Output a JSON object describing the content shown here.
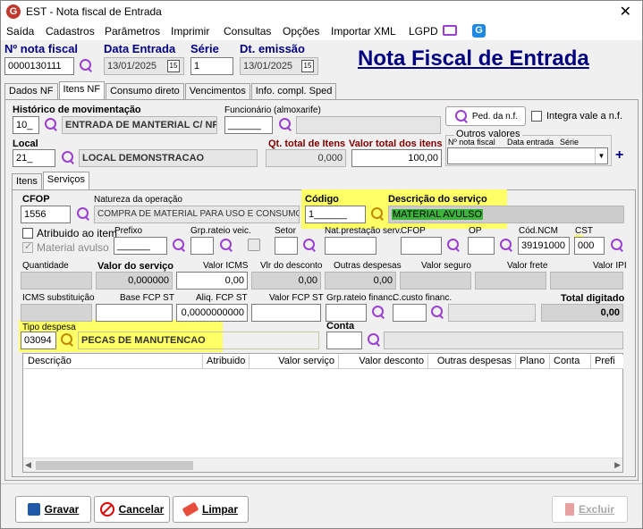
{
  "window": {
    "title": "EST - Nota fiscal de Entrada",
    "icon": "G"
  },
  "menu": [
    "Saída",
    "Cadastros",
    "Parâmetros",
    "Imprimir",
    "Consultas",
    "Opções",
    "Importar XML",
    "LGPD"
  ],
  "header": {
    "nota_label": "Nº nota fiscal",
    "nota_value": "0000130111",
    "data_entrada_label": "Data Entrada",
    "data_entrada_value": "13/01/2025",
    "serie_label": "Série",
    "serie_value": "1",
    "dt_emissao_label": "Dt. emissão",
    "dt_emissao_value": "13/01/2025",
    "big_title": "Nota Fiscal de Entrada",
    "cal_glyph": "15"
  },
  "main_tabs": [
    "Dados NF",
    "Itens NF",
    "Consumo direto",
    "Vencimentos",
    "Info. compl. Sped"
  ],
  "itens": {
    "historico_label": "Histórico de movimentação",
    "historico_code": "10_",
    "historico_desc": "ENTRADA DE MANTERIAL C/ NF",
    "funcionario_label": "Funcionário (almoxarife)",
    "funcionario_value": "______",
    "ped_btn": "Ped. da n.f.",
    "integra_label": "Integra vale a n.f.",
    "outros_valores_label": "Outros valores",
    "ov_cols": [
      "Nº nota fiscal",
      "Data entrada",
      "Série"
    ],
    "local_label": "Local",
    "local_code": "21_",
    "local_desc": "LOCAL DEMONSTRACAO",
    "qt_total_label": "Qt. total de Itens",
    "qt_total_value": "0,000",
    "valor_total_label": "Valor total dos itens",
    "valor_total_value": "100,00",
    "plus": "+"
  },
  "sub_tabs": [
    "Itens",
    "Serviços"
  ],
  "servicos": {
    "cfop_label": "CFOP",
    "cfop_value": "1556",
    "natureza_label": "Natureza da operação",
    "natureza_value": "COMPRA DE MATERIAL PARA USO E CONSUMO -",
    "codigo_label": "Código",
    "codigo_value": "1______",
    "desc_servico_label": "Descrição do serviço",
    "desc_servico_value": "MATERIAL AVULSO",
    "atribuido_label": "Atribuido ao item",
    "material_avulso_label": "Material avulso",
    "prefixo_label": "Prefixo",
    "prefixo_value": "______",
    "grp_rateio_label": "Grp.rateio veic.",
    "setor_label": "Setor",
    "nat_prest_label": "Nat.prestação serv.",
    "cfop2_label": "CFOP",
    "op_label": "OP",
    "cod_ncm_label": "Cód.NCM",
    "cod_ncm_value": "39191000",
    "cst_label": "CST",
    "cst_value": "000",
    "quantidade_label": "Quantidade",
    "valor_servico_label": "Valor do serviço",
    "valor_servico_value": "0,000000",
    "valor_icms_label": "Valor ICMS",
    "valor_icms_value": "0,00",
    "vlr_desconto_label": "Vlr do desconto",
    "vlr_desconto_value": "0,00",
    "outras_despesas_label": "Outras despesas",
    "outras_despesas_value": "0,00",
    "valor_seguro_label": "Valor seguro",
    "valor_frete_label": "Valor frete",
    "valor_ipi_label": "Valor IPI",
    "icms_subst_label": "ICMS substituição",
    "base_fcp_label": "Base FCP ST",
    "aliq_fcp_label": "Aliq. FCP ST",
    "aliq_fcp_value": "0,0000000000",
    "valor_fcp_label": "Valor FCP ST",
    "grp_rateio_fin_label": "Grp.rateio financ.",
    "c_custo_label": "C.custo financ.",
    "total_digitado_label": "Total digitado",
    "total_digitado_value": "0,00",
    "tipo_despesa_label": "Tipo despesa",
    "tipo_despesa_code": "03094",
    "tipo_despesa_desc": "PECAS DE MANUTENCAO",
    "conta_label": "Conta",
    "grid_cols": [
      "Descrição",
      "Atribuido",
      "Valor serviço",
      "Valor desconto",
      "Outras despesas",
      "Plano",
      "Conta",
      "Prefi"
    ]
  },
  "buttons": {
    "gravar": "Gravar",
    "cancelar": "Cancelar",
    "limpar": "Limpar",
    "excluir": "Excluir"
  },
  "colors": {
    "highlight": "#ffff66",
    "title_blue": "#000080",
    "accent_purple": "#9b3fd0"
  }
}
